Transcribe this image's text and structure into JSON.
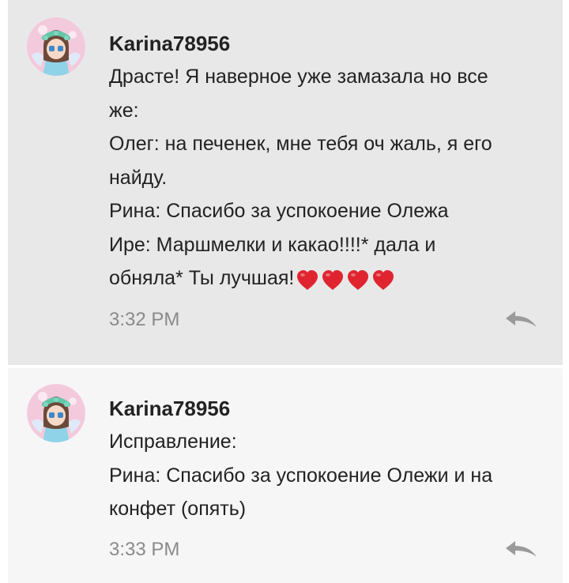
{
  "messages": [
    {
      "username": "Karina78956",
      "lines": [
        "Драсте! Я наверное уже замазала но все",
        "же:",
        "Олег: на печенек, мне тебя оч жаль, я его",
        "найду.",
        "Рина: Спасибо за успокоение Олежа",
        "Ире: Маршмелки и какао!!!!* дала и",
        "обняла* Ты лучшая!"
      ],
      "hearts_count": 4,
      "heart_color": "#e0242f",
      "time": "3:32 PM",
      "reply_icon": "reply-arrow-icon"
    },
    {
      "username": "Karina78956",
      "lines": [
        "Исправление:",
        "Рина: Спасибо за успокоение Олежи и на",
        "конфет (опять)"
      ],
      "time": "3:33 PM",
      "reply_icon": "reply-arrow-icon"
    }
  ],
  "colors": {
    "selected_background": "#e8e8e8",
    "message_background": "#f6f6f6",
    "text": "#222222",
    "timestamp": "#8a8a8a",
    "icon": "#9a9a9a"
  }
}
